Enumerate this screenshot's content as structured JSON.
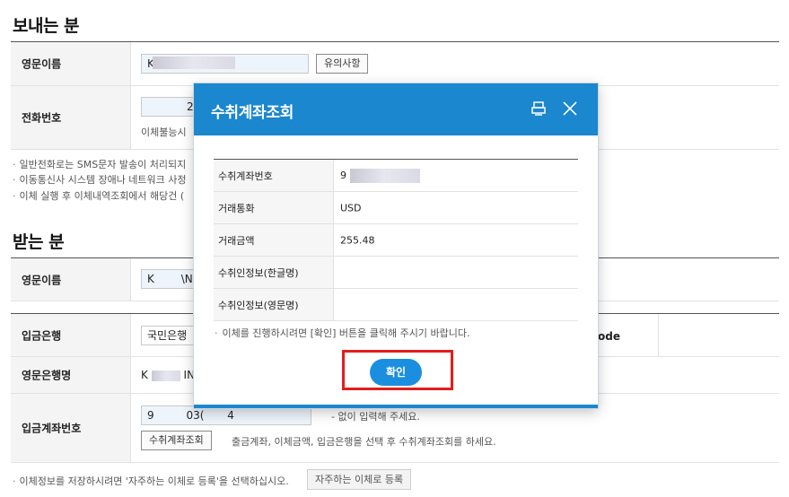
{
  "sender": {
    "title": "보내는 분",
    "english_name_label": "영문이름",
    "english_name_value": "K",
    "caution_button": "유의사항",
    "phone_label": "전화번호",
    "phone_value": "2",
    "phone_help": "이체불능시"
  },
  "notes": [
    "일반전화로는 SMS문자 발송이 처리되지",
    "이동통신사 시스템 장애나 네트워크 사정",
    "이체 실행 후 이체내역조회에서 해당건 ("
  ],
  "receiver": {
    "title": "받는 분",
    "english_name_label": "영문이름",
    "english_name_value": "K",
    "english_name_tail": "\\N",
    "bank_label": "입금은행",
    "bank_value": "국민은행",
    "swift_label": "ode",
    "bank_english_label": "영문은행명",
    "bank_english_value": "K",
    "bank_english_tail": "IN",
    "account_label": "입금계좌번호",
    "account_value": "9",
    "account_mid": "03(",
    "account_end": "4",
    "account_hint": "- 없이 입력해 주세요.",
    "lookup_button": "수취계좌조회",
    "lookup_help": "출금계좌, 이체금액, 입금은행을 선택 후 수취계좌조회를 하세요."
  },
  "footer": {
    "note": "이체정보를 저장하시려면 '자주하는 이체로 등록'을 선택하십시오.",
    "register_button": "자주하는 이체로 등록"
  },
  "modal": {
    "title": "수취계좌조회",
    "rows": [
      {
        "label": "수취계좌번호",
        "value": "9"
      },
      {
        "label": "거래통화",
        "value": "USD"
      },
      {
        "label": "거래금액",
        "value": "255.48"
      },
      {
        "label": "수취인정보(한글명)",
        "value": ""
      },
      {
        "label": "수취인정보(영문명)",
        "value": ""
      }
    ],
    "note": "이체를 진행하시려면 [확인] 버튼을 클릭해 주시기 바랍니다.",
    "confirm_label": "확인"
  }
}
